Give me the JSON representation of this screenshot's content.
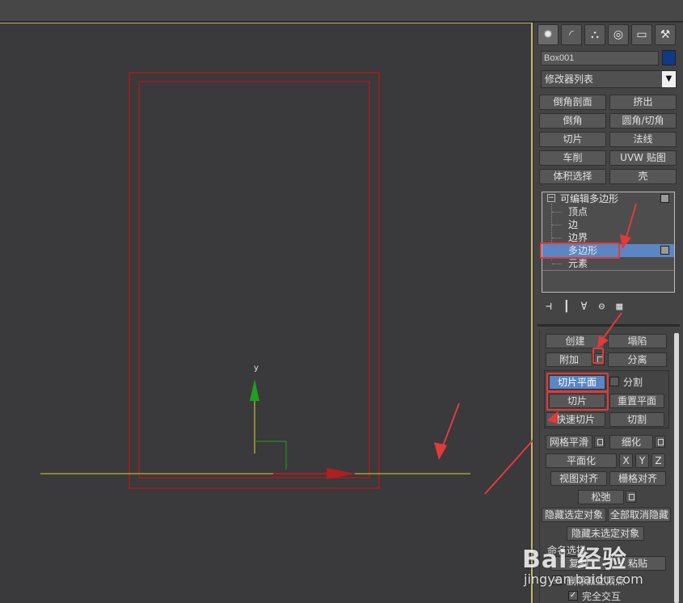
{
  "command_panel": {
    "tab_icons": [
      "create-icon",
      "modify-icon",
      "hierarchy-icon",
      "motion-icon",
      "display-icon",
      "utilities-icon"
    ],
    "object_name": "Box001",
    "object_color": "#0f3a8a",
    "modifier_list": "修改器列表",
    "modifier_buttons": [
      "倒角剖面",
      "挤出",
      "倒角",
      "圆角/切角",
      "切片",
      "法线",
      "车削",
      "UVW 贴图",
      "体积选择",
      "壳"
    ],
    "stack": {
      "root": "可编辑多边形",
      "subobjects": [
        "顶点",
        "边",
        "边界",
        "多边形",
        "元素"
      ],
      "selected": "多边形"
    }
  },
  "edit_geometry": {
    "create": "创建",
    "collapse": "塌陷",
    "attach": "附加",
    "detach": "分离",
    "slice_plane": "切片平面",
    "split": "分割",
    "slice": "切片",
    "reset_plane": "重置平面",
    "quickslice": "快速切片",
    "cut": "切割",
    "meshsmooth": "网格平滑",
    "tessellate": "细化",
    "make_planar": "平面化",
    "x": "X",
    "y": "Y",
    "z": "Z",
    "view_align": "视图对齐",
    "grid_align": "栅格对齐",
    "relax": "松弛",
    "hide_selected": "隐藏选定对象",
    "unhide_all": "全部取消隐藏",
    "hide_unselected": "隐藏未选定对象",
    "named_selections": "命名选择:",
    "copy": "复制",
    "paste": "粘贴",
    "delete_isolated": "删除孤立顶点",
    "full_interactivity": "完全交互"
  },
  "viewport": {
    "axis_label": "y"
  },
  "watermark": {
    "main": "Bai 经验",
    "sub": "jingyan.baidu.com"
  },
  "colors": {
    "highlight_red": "#e23a3a",
    "selection_blue": "#5b86c3",
    "object_wire": "#b01e1e",
    "gizmo_green": "#1fa01f",
    "gizmo_yellow": "#d8d82a"
  }
}
